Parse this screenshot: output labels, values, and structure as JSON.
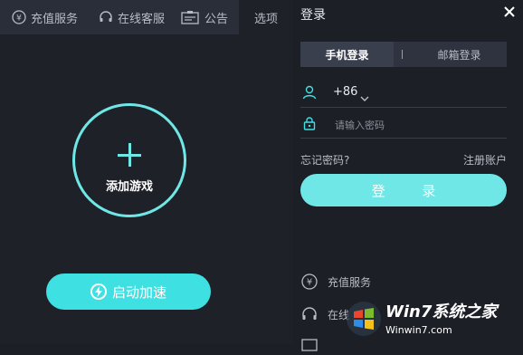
{
  "topnav": {
    "recharge": "充值服务",
    "online_service": "在线客服",
    "notice": "公告",
    "options": "选项"
  },
  "main": {
    "add_game": "添加游戏",
    "accelerate": "启动加速"
  },
  "login": {
    "title": "登录",
    "tab_phone": "手机登录",
    "tab_email": "邮箱登录",
    "phone_code": "+86",
    "password_placeholder": "请输入密码",
    "forgot": "忘记密码?",
    "register": "注册账户",
    "login_button": "登 录"
  },
  "side_menu": {
    "recharge": "充值服务",
    "online_service": "在线"
  },
  "watermark": {
    "brand": "Win7系统之家",
    "url": "Winwin7.com"
  },
  "colors": {
    "accent": "#3fe0e2",
    "accent_light": "#6ee7e6",
    "background": "#1e2128",
    "nav": "#2a2e39"
  }
}
